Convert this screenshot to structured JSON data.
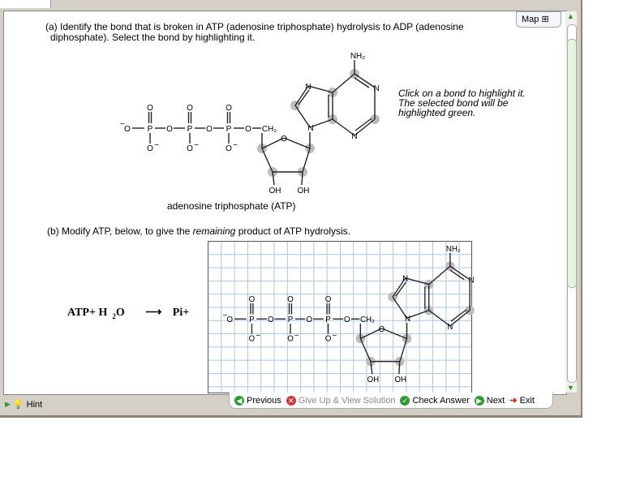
{
  "question_a": {
    "line1": "(a) Identify the bond that is broken in ATP (adenosine triphosphate) hydrolysis to ADP (adenosine",
    "line2": "diphosphate). Select the bond by highlighting it."
  },
  "map_label": "Map",
  "instruction": "Click on a bond to highlight it. The selected bond will be highlighted green.",
  "molecule_caption": "adenosine triphosphate (ATP)",
  "question_b": {
    "prefix": "(b) Modify ATP, below, to give the ",
    "emph": "remaining",
    "suffix": " product of ATP hydrolysis."
  },
  "equation": {
    "left": "ATP+ H",
    "sub": "2",
    "o": "O",
    "arrow": "⟶",
    "right": "Pi+"
  },
  "atoms": {
    "O": "O",
    "P": "P",
    "N": "N",
    "NH2": "NH₂",
    "CH2": "CH₂",
    "OH": "OH",
    "minus": "−"
  },
  "nav": {
    "previous": "Previous",
    "give_up": "Give Up & View Solution",
    "check": "Check Answer",
    "next": "Next",
    "exit": "Exit"
  },
  "hint": "Hint",
  "colors": {
    "green": "#2f9a2f",
    "red": "#cc2a2a",
    "highlight": "#bdbdbd"
  }
}
